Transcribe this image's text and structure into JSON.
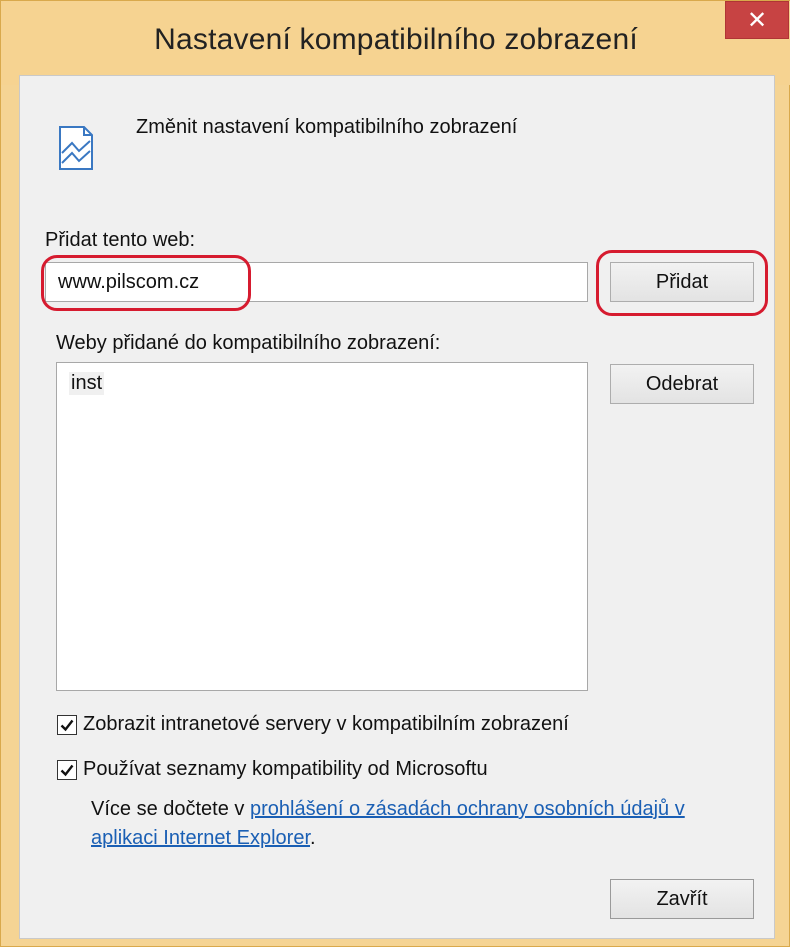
{
  "window": {
    "title": "Nastavení kompatibilního zobrazení",
    "close_glyph": "✕",
    "frame_color": "#f6d391",
    "close_color": "#c74343"
  },
  "header": {
    "icon": "compat-view-icon",
    "text": "Změnit nastavení kompatibilního zobrazení"
  },
  "add_site": {
    "label": "Přidat tento web:",
    "value": "www.pilscom.cz",
    "button": "Přidat"
  },
  "site_list": {
    "label": "Weby přidané do kompatibilního zobrazení:",
    "items": [
      "inst"
    ],
    "remove_button": "Odebrat"
  },
  "options": {
    "intranet": {
      "label": "Zobrazit intranetové servery v kompatibilním zobrazení",
      "checked": true
    },
    "ms_lists": {
      "label": "Používat seznamy kompatibility od Microsoftu",
      "checked": true
    }
  },
  "info": {
    "prefix": "Více se dočtete v ",
    "link": "prohlášení o zásadách ochrany osobních údajů v aplikaci Internet Explorer",
    "suffix": "."
  },
  "footer": {
    "close_button": "Zavřít"
  },
  "annotation_color": "#d61b2f"
}
